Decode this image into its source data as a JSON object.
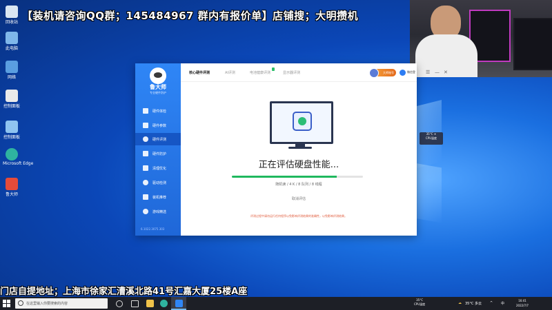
{
  "banner": "【装机请咨询QQ群；145484967 群内有报价单】店铺搜；大明攒机",
  "address": "门店自提地址；上海市徐家汇漕溪北路41号汇嘉大厦25楼A座",
  "desktop_icons": [
    "回收站",
    "此电脑",
    "网络",
    "控制面板",
    "Microsoft Edge",
    "鲁大师"
  ],
  "app": {
    "brand": "鲁大师",
    "slogan": "专业硬件防护",
    "nav": [
      {
        "label": "硬件体检",
        "icon": "monitor-icon"
      },
      {
        "label": "硬件参数",
        "icon": "list-icon"
      },
      {
        "label": "硬件评测",
        "icon": "gauge-icon"
      },
      {
        "label": "硬件防护",
        "icon": "shield-icon"
      },
      {
        "label": "清理优化",
        "icon": "broom-icon"
      },
      {
        "label": "驱动检测",
        "icon": "driver-icon"
      },
      {
        "label": "装机推荐",
        "icon": "pc-icon"
      },
      {
        "label": "游戏精选",
        "icon": "game-icon"
      }
    ],
    "active_nav": "硬件评测",
    "version": "6.1022.3075.303",
    "tabs": [
      "核心硬件评测",
      "AI评测",
      "电池健康评测",
      "显示器评测"
    ],
    "user_label": "大师账号",
    "wechat_label": "微信登",
    "win_controls": [
      "☰",
      "—",
      "✕"
    ],
    "status_text": "正在评估硬盘性能...",
    "progress": 0.8,
    "detail": "随机读 / 4 K / 8 队列 / 8 线程",
    "cancel_label": "取消评估",
    "warning": "评测过程中请勿运行任何程序以免影响评测结果的准确性，以免影响评测结果。"
  },
  "taskbar": {
    "search_placeholder": "在这里输入你要搜索的内容",
    "cpu_temp": "35°C",
    "cpu_label": "CPU温度",
    "weather": "35°C 多云",
    "lang": "中",
    "time": "16:41",
    "date": "2022/7/7"
  },
  "widget": {
    "line1": "35°C ☀",
    "line2": "CPU温度"
  },
  "colors": {
    "accent": "#1f67d8",
    "progress": "#1fb85e",
    "taskbar": "#1d1f26"
  }
}
